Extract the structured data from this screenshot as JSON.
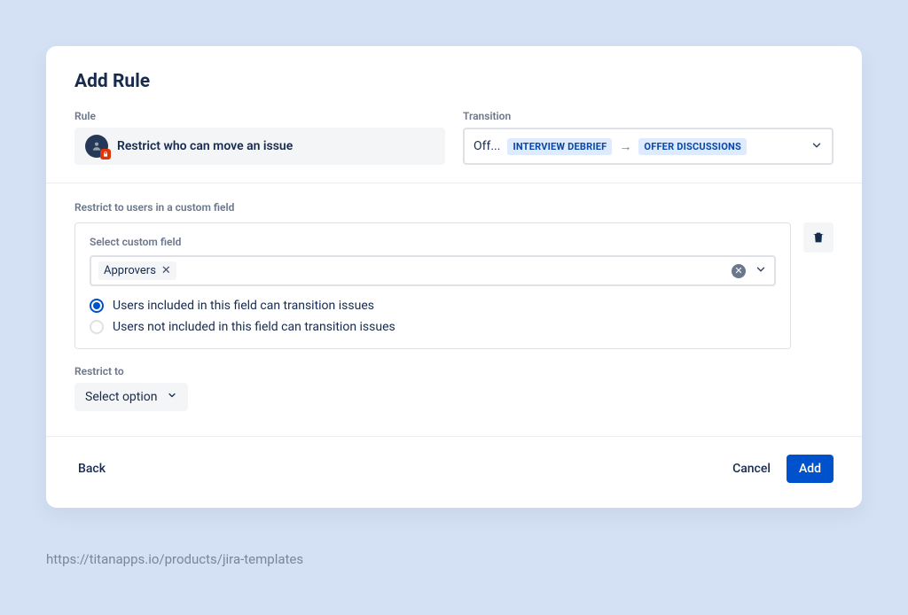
{
  "modal": {
    "title": "Add Rule",
    "rule_label": "Rule",
    "rule_name": "Restrict who can move an issue",
    "transition_label": "Transition",
    "transition_prefix": "Off...",
    "transition_from": "INTERVIEW DEBRIEF",
    "transition_to": "OFFER DISCUSSIONS"
  },
  "restrict_section": {
    "heading": "Restrict to users in a custom field",
    "panel_label": "Select custom field",
    "selected_tag": "Approvers",
    "radios": {
      "included": "Users included in this field can transition issues",
      "not_included": "Users not included in this field can transition issues"
    }
  },
  "restrict_to": {
    "label": "Restrict to",
    "placeholder": "Select option"
  },
  "footer": {
    "back": "Back",
    "cancel": "Cancel",
    "add": "Add"
  },
  "url": "https://titanapps.io/products/jira-templates"
}
